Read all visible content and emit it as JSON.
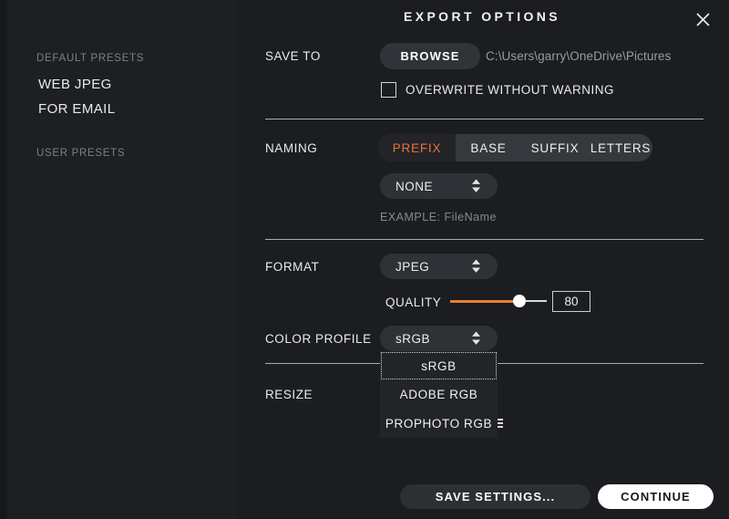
{
  "window": {
    "title": "EXPORT OPTIONS",
    "close_icon": "close-icon"
  },
  "sidebar": {
    "groups": [
      {
        "label": "DEFAULT PRESETS",
        "items": [
          {
            "label": "WEB JPEG"
          },
          {
            "label": "FOR EMAIL"
          }
        ]
      },
      {
        "label": "USER PRESETS",
        "items": []
      }
    ]
  },
  "save_to": {
    "label": "SAVE TO",
    "browse_label": "BROWSE",
    "path": "C:\\Users\\garry\\OneDrive\\Pictures",
    "overwrite": {
      "label": "OVERWRITE WITHOUT WARNING",
      "checked": false
    }
  },
  "naming": {
    "label": "NAMING",
    "tabs": [
      {
        "label": "PREFIX",
        "active": true
      },
      {
        "label": "BASE",
        "active": false
      },
      {
        "label": "SUFFIX",
        "active": false
      },
      {
        "label": "LETTERS",
        "active": false
      }
    ],
    "select_value": "NONE",
    "example": "EXAMPLE: FileName"
  },
  "format": {
    "label": "FORMAT",
    "value": "JPEG",
    "quality": {
      "label": "QUALITY",
      "value": "80",
      "percent": 80
    }
  },
  "color_profile": {
    "label": "COLOR PROFILE",
    "value": "sRGB",
    "open": true,
    "options": [
      {
        "label": "sRGB",
        "selected": true
      },
      {
        "label": "ADOBE RGB",
        "selected": false
      },
      {
        "label": "PROPHOTO RGB",
        "selected": false
      }
    ]
  },
  "resize": {
    "label": "RESIZE"
  },
  "footer": {
    "save_settings_label": "SAVE SETTINGS...",
    "continue_label": "CONTINUE"
  },
  "colors": {
    "accent_orange": "#e8713a",
    "slider_orange": "#e87e36",
    "panel_bg": "#1b1d20",
    "sidebar_bg": "#1d1f23",
    "dropdown_bg": "#222427"
  }
}
